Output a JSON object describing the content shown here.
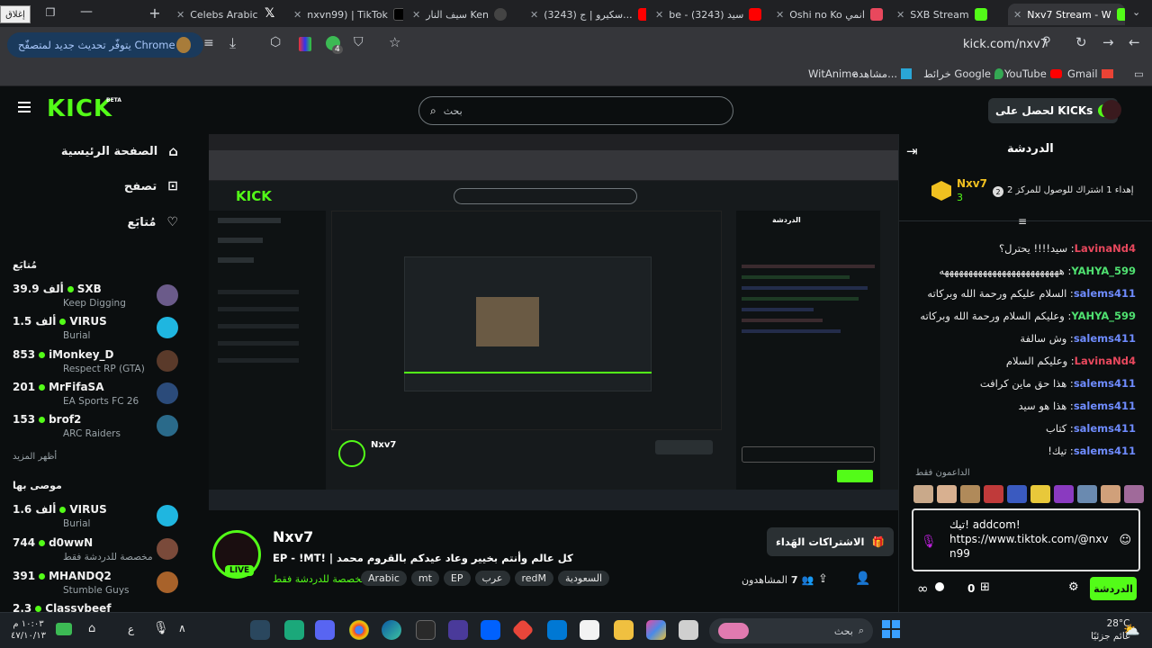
{
  "browser": {
    "close_tooltip": "إغلاق",
    "tabs": [
      {
        "title": "Celebs Arabic"
      },
      {
        "title": "nxvn99) | TikTok"
      },
      {
        "title": "سيف النار Ken"
      },
      {
        "title": "(3243) سكيرو | ج..."
      },
      {
        "title": "be - سيد (3243)"
      },
      {
        "title": "Oshi no Ko انمي"
      },
      {
        "title": "SXB Stream"
      },
      {
        "title": "Nxv7 Stream - W"
      }
    ],
    "update_button": "يتوفّر تحديث جديد لمتصفّح Chrome",
    "extension_badge": "4",
    "url": "kick.com/nxv7",
    "bookmarks": [
      "Gmail",
      "YouTube",
      "خرائط Google",
      "مشاهدة...",
      "WitAnime"
    ]
  },
  "kick": {
    "logo": "KICK",
    "logo_beta": "BETA",
    "search_placeholder": "بحث",
    "get_kicks": "لحصل على KICKs",
    "nav": {
      "home": "الصفحة الرئيسية",
      "browse": "تصفح",
      "following": "مُتابَع"
    },
    "following_title": "مُتابَع",
    "following": [
      {
        "count": "39.9 ألف",
        "name": "SXB",
        "category": "Keep Digging",
        "color": "#6b5b8a"
      },
      {
        "count": "1.5 ألف",
        "name": "VIRUS",
        "category": "Burial",
        "color": "#1fb6e0"
      },
      {
        "count": "853",
        "name": "iMonkey_D",
        "category": "Respect RP (GTA)",
        "color": "#5a3a2a"
      },
      {
        "count": "201",
        "name": "MrFifaSA",
        "category": "EA Sports FC 26",
        "color": "#2b4b7a"
      },
      {
        "count": "153",
        "name": "brof2",
        "category": "ARC Raiders",
        "color": "#2a6a8a"
      }
    ],
    "show_more": "أظهر المزيد",
    "recommended_title": "موصى بها",
    "recommended": [
      {
        "count": "1.6 ألف",
        "name": "VIRUS",
        "category": "Burial",
        "color": "#1fb6e0"
      },
      {
        "count": "744",
        "name": "d0wwN",
        "category": "مخصصة للدردشة فقط",
        "color": "#7a4a3a"
      },
      {
        "count": "391",
        "name": "MHANDQ2",
        "category": "Stumble Guys",
        "color": "#a8622a"
      },
      {
        "count": "2.3",
        "name": "Classybeef",
        "category": "",
        "color": "#8a7a2a"
      }
    ],
    "stream": {
      "streamer": "Nxv7",
      "title": "كل عالم وأنتم بخيير وعاد عيدكم بالقروم محمد | !EP - !MT",
      "category": "مخصصة للدردشة فقط",
      "live": "LIVE",
      "tags": [
        "Arabic",
        "mt",
        "EP",
        "عرب",
        "redM",
        "السعودية"
      ],
      "subscribe": "الاشتراكات الهَداء",
      "viewers": "7",
      "viewers_label": "المشاهدون"
    },
    "chat": {
      "title": "الدردشة",
      "pinned_user": "Nxv7",
      "pinned_user_count": "3",
      "pinned_text": "إهداء 1 اشتراك للوصول للمركز 2",
      "pinned_rank": "2",
      "messages": [
        {
          "user": "LavinaNd4",
          "color": "#e8485d",
          "text": "سيد!!!! يحترل؟"
        },
        {
          "user": "YAHYA_599",
          "color": "#4fe070",
          "text": "هههههههههههههههههههههههههه"
        },
        {
          "user": "salems411",
          "color": "#6f8cff",
          "text": "السلام عليكم ورحمة الله وبركاته"
        },
        {
          "user": "YAHYA_599",
          "color": "#4fe070",
          "text": "وعليكم السلام ورحمة الله وبركاته"
        },
        {
          "user": "salems411",
          "color": "#6f8cff",
          "text": "وش سالفة"
        },
        {
          "user": "LavinaNd4",
          "color": "#e8485d",
          "text": "وعليكم السلام"
        },
        {
          "user": "salems411",
          "color": "#6f8cff",
          "text": "هذا حق ماين كرافت"
        },
        {
          "user": "salems411",
          "color": "#6f8cff",
          "text": "هذا هو سيد"
        },
        {
          "user": "salems411",
          "color": "#6f8cff",
          "text": "كتاب"
        },
        {
          "user": "salems411",
          "color": "#6f8cff",
          "text": "تيك!"
        }
      ],
      "supporters_label": "الداعمون فقط",
      "input_text": "تيك! addcom!\nhttps://www.tiktok.com/@nxvn99",
      "kicks_count": "0",
      "send_button": "الدردشة"
    }
  },
  "taskbar": {
    "weather_temp": "28°C",
    "weather_text": "غائم جزئيًا",
    "search_placeholder": "بحث",
    "time": "١٠:٠٣ م",
    "date": "٤٧/١٠/١٣",
    "lang": "ع"
  }
}
